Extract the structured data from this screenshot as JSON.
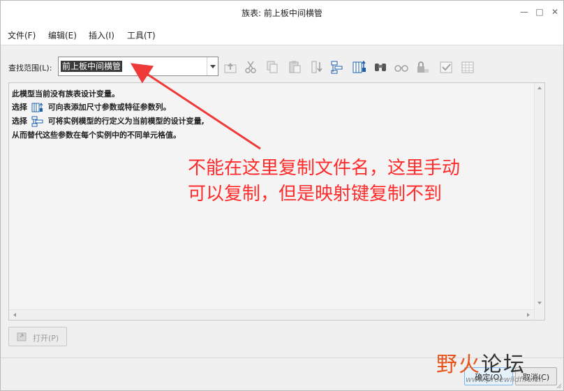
{
  "window": {
    "title": "族表: 前上板中间横管"
  },
  "menu": [
    "文件(F)",
    "编辑(E)",
    "插入(I)",
    "工具(T)"
  ],
  "scope": {
    "label": "查找范围(L):",
    "value": "前上板中间横管"
  },
  "toolbar_icons": [
    "up-level-icon",
    "cut-icon",
    "copy-icon",
    "paste-icon",
    "insert-column-icon",
    "add-instance-icon",
    "add-item-icon",
    "find-icon",
    "glasses-icon",
    "lock-icon",
    "verify-icon",
    "table-icon"
  ],
  "content": {
    "line1": "此模型当前没有族表设计变量。",
    "line2_prefix": "选择",
    "line2_suffix": "可向表添加尺寸参数或特征参数列。",
    "line3_prefix": "选择",
    "line3_suffix": "可将实例模型的行定义为当前模型的设计变量,",
    "line4": "从而替代这些参数在每个实例中的不同单元格值。"
  },
  "annotation": {
    "line1": "不能在这里复制文件名，这里手动",
    "line2": "可以复制，但是映射键复制不到",
    "color": "#ff2b2b"
  },
  "buttons": {
    "open": "打开(P)",
    "ok": "确定(O)",
    "cancel": "取消(C)"
  },
  "watermark": {
    "part1": "野火",
    "part2": "论坛",
    "url": "www.proewildfire.cn"
  }
}
